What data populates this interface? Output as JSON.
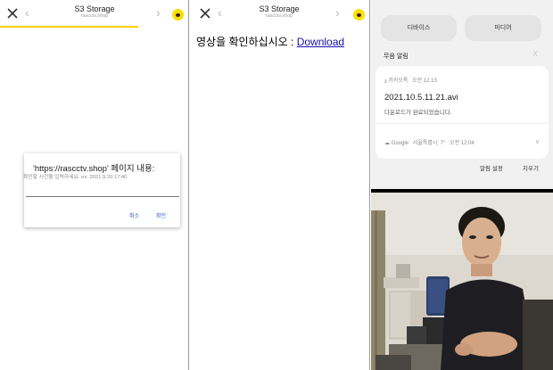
{
  "browser": {
    "title": "S3 Storage",
    "domain": "rascctv.shop"
  },
  "dialog": {
    "title": "'https://rascctv.shop' 페이지 내용:",
    "message": "확인할 시간을 입력하세요. ex: 2021.9.20.17:40",
    "input_value": "",
    "cancel_label": "취소",
    "ok_label": "확인"
  },
  "page2": {
    "message": "영상을 확인하십시오 : ",
    "link_label": "Download"
  },
  "shade": {
    "tab_devices": "디바이스",
    "tab_media": "미디어",
    "silent_title": "무음 알림",
    "silent_close": "X",
    "notif1": {
      "app": "카카오톡",
      "time": "오전 12:13",
      "filename": "2021.10.5.11.21.avi",
      "status": "다운로드가 완료되었습니다."
    },
    "notif2": {
      "app": "Google",
      "detail": "서울특별시: 7°",
      "time": "오전 12:04"
    },
    "settings_label": "알림 설정",
    "clear_label": "지우기"
  },
  "colors": {
    "kakao_yellow": "#F9E000",
    "progress": "#FFCD00",
    "dialog_button": "#2F5FD0",
    "link": "#1A0DAB"
  }
}
